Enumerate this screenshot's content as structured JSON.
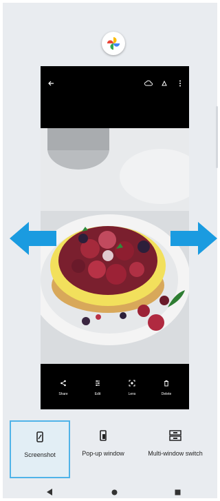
{
  "app": {
    "icon": "google-photos-pinwheel-icon"
  },
  "viewer": {
    "top_icons": [
      "back-arrow-icon",
      "cloud-upload-icon",
      "cast-icon",
      "more-vert-icon"
    ],
    "photo": {
      "subject": "berry-tart-photo"
    },
    "actions": [
      {
        "icon": "share-icon",
        "label": "Share"
      },
      {
        "icon": "edit-icon",
        "label": "Edit"
      },
      {
        "icon": "lens-icon",
        "label": "Lens"
      },
      {
        "icon": "delete-icon",
        "label": "Delete"
      }
    ]
  },
  "swipe_arrows": {
    "color": "#1a9be0",
    "icons": [
      "arrow-left-icon",
      "arrow-right-icon"
    ]
  },
  "options": [
    {
      "icon": "screenshot-icon",
      "label": "Screenshot",
      "selected": true
    },
    {
      "icon": "pop-up-window-icon",
      "label": "Pop-up window",
      "selected": false
    },
    {
      "icon": "multi-window-switch-icon",
      "label": "Multi-window switch",
      "selected": false
    }
  ],
  "navbar": {
    "icons": [
      "back-triangle-icon",
      "home-circle-icon",
      "recents-square-icon"
    ]
  },
  "colors": {
    "accent": "#4fb3e8",
    "selected_bg": "#e2eef5",
    "screen_bg": "#e9ecf0"
  }
}
